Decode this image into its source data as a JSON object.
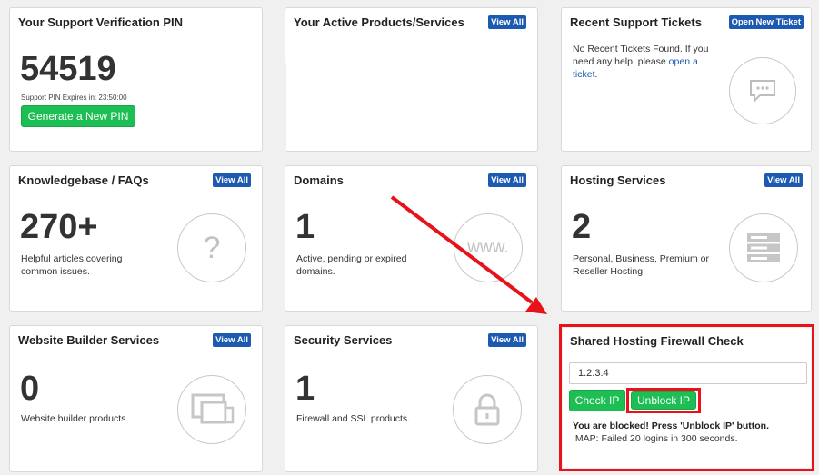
{
  "pin_card": {
    "title": "Your Support Verification PIN",
    "pin": "54519",
    "expires": "Support PIN Expires in: 23:50:00",
    "generate_label": "Generate a New PIN"
  },
  "products_card": {
    "title": "Your Active Products/Services",
    "view_all": "View All"
  },
  "tickets_card": {
    "title": "Recent Support Tickets",
    "open_new": "Open New Ticket",
    "text": "No Recent Tickets Found. If you need any help, please",
    "link": "open a ticket",
    "period": "."
  },
  "kb_card": {
    "title": "Knowledgebase / FAQs",
    "view_all": "View All",
    "count": "270+",
    "desc_line1": "Helpful articles covering",
    "desc_line2": "common issues.",
    "icon_glyph": "?"
  },
  "domains_card": {
    "title": "Domains",
    "view_all": "View All",
    "count": "1",
    "desc_line1": "Active, pending or expired",
    "desc_line2": "domains.",
    "icon_text": "www."
  },
  "hosting_card": {
    "title": "Hosting Services",
    "view_all": "View All",
    "count": "2",
    "desc_line1": "Personal, Business, Premium or",
    "desc_line2": "Reseller Hosting."
  },
  "builder_card": {
    "title": "Website Builder Services",
    "view_all": "View All",
    "count": "0",
    "desc_line1": "Website builder products."
  },
  "security_card": {
    "title": "Security Services",
    "view_all": "View All",
    "count": "1",
    "desc_line1": "Firewall and SSL products."
  },
  "firewall_card": {
    "title": "Shared Hosting Firewall Check",
    "ip_value": "1.2.3.4",
    "check_label": "Check IP",
    "unblock_label": "Unblock IP",
    "blocked_msg": "You are blocked! Press 'Unblock IP' button.",
    "detail_msg": "IMAP: Failed 20 logins in 300 seconds."
  },
  "colors": {
    "accent_blue": "#1c59b0",
    "green": "#1dbf54",
    "highlight_red": "#e8121b"
  }
}
